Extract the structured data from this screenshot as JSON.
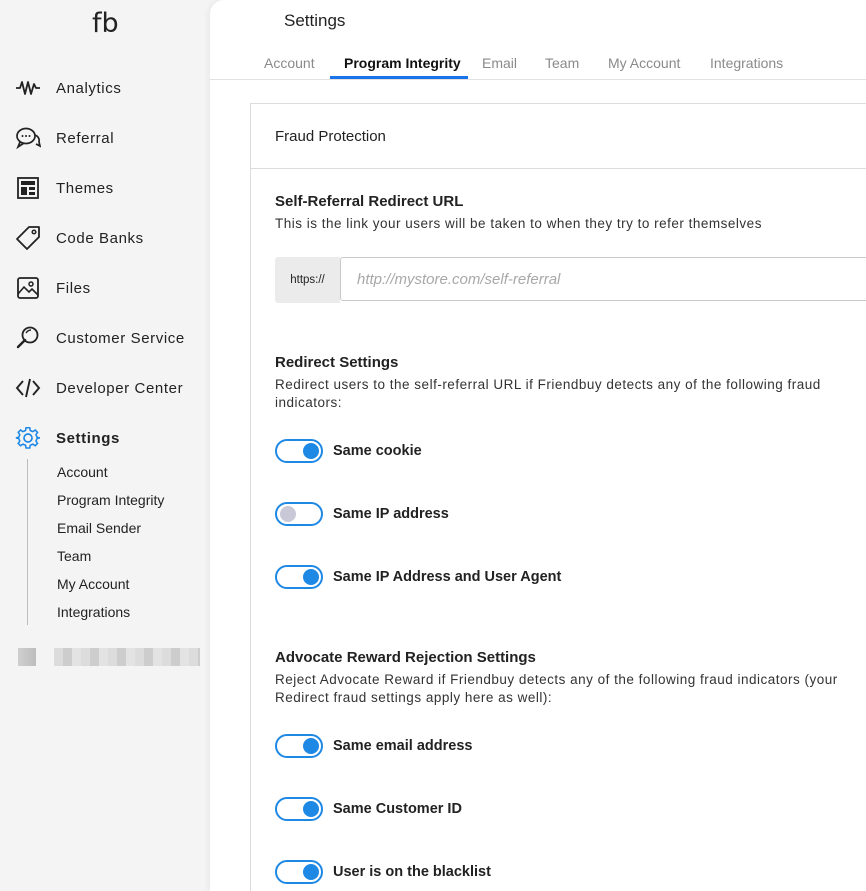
{
  "app": {
    "logo": "fb"
  },
  "sidebar": {
    "items": [
      {
        "label": "Analytics",
        "icon": "analytics-icon"
      },
      {
        "label": "Referral",
        "icon": "chat-bubbles-icon"
      },
      {
        "label": "Themes",
        "icon": "layout-icon"
      },
      {
        "label": "Code Banks",
        "icon": "tag-icon"
      },
      {
        "label": "Files",
        "icon": "image-icon"
      },
      {
        "label": "Customer Service",
        "icon": "search-icon"
      },
      {
        "label": "Developer Center",
        "icon": "code-icon"
      },
      {
        "label": "Settings",
        "icon": "gear-icon",
        "active": true
      }
    ],
    "sub_items": [
      {
        "label": "Account"
      },
      {
        "label": "Program Integrity"
      },
      {
        "label": "Email Sender"
      },
      {
        "label": "Team"
      },
      {
        "label": "My Account"
      },
      {
        "label": "Integrations"
      }
    ]
  },
  "header": {
    "title": "Settings",
    "tabs": [
      {
        "label": "Account"
      },
      {
        "label": "Program Integrity",
        "active": true
      },
      {
        "label": "Email"
      },
      {
        "label": "Team"
      },
      {
        "label": "My Account"
      },
      {
        "label": "Integrations"
      }
    ]
  },
  "card": {
    "title": "Fraud Protection",
    "self_referral": {
      "title": "Self-Referral Redirect URL",
      "description": "This is the link your users will be taken to when they try to refer themselves",
      "prefix": "https://",
      "placeholder": "http://mystore.com/self-referral",
      "value": ""
    },
    "redirect": {
      "title": "Redirect Settings",
      "description": "Redirect users to the self-referral URL if Friendbuy detects any of the following fraud indicators:",
      "toggles": [
        {
          "label": "Same cookie",
          "on": true
        },
        {
          "label": "Same IP address",
          "on": false
        },
        {
          "label": "Same IP Address and User Agent",
          "on": true
        }
      ]
    },
    "advocate": {
      "title": "Advocate Reward Rejection Settings",
      "description": "Reject Advocate Reward if Friendbuy detects any of the following fraud indicators (your Redirect fraud settings apply here as well):",
      "toggles": [
        {
          "label": "Same email address",
          "on": true
        },
        {
          "label": "Same Customer ID",
          "on": true
        },
        {
          "label": "User is on the blacklist",
          "on": true
        }
      ]
    }
  },
  "colors": {
    "accent": "#1e88e5",
    "toggle_off_knob": "#c8c8d6"
  }
}
